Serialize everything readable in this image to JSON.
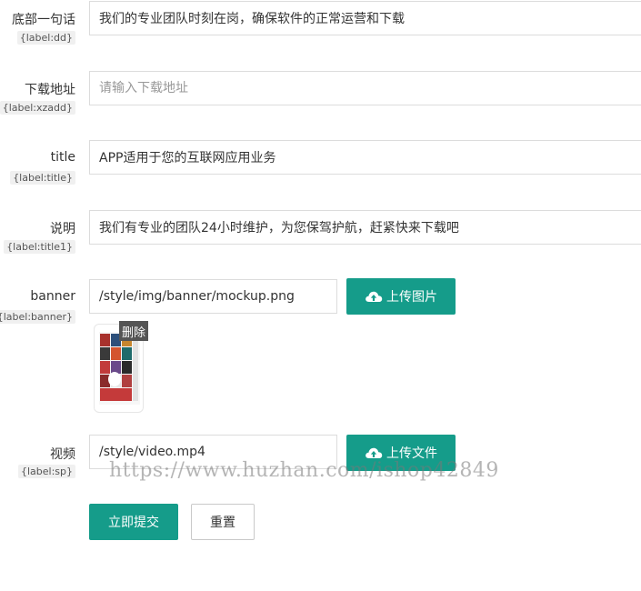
{
  "fields": [
    {
      "label": "底部一句话",
      "tag": "{label:dd}",
      "value": "我们的专业团队时刻在岗，确保软件的正常运营和下载",
      "placeholder": ""
    },
    {
      "label": "下载地址",
      "tag": "{label:xzadd}",
      "value": "",
      "placeholder": "请输入下载地址"
    },
    {
      "label": "title",
      "tag": "{label:title}",
      "value": "APP适用于您的互联网应用业务",
      "placeholder": ""
    },
    {
      "label": "说明",
      "tag": "{label:title1}",
      "value": "我们有专业的团队24小时维护，为您保驾护航，赶紧快来下载吧",
      "placeholder": ""
    }
  ],
  "banner": {
    "label": "banner",
    "tag": "{label:banner}",
    "value": "/style/img/banner/mockup.png",
    "upload_label": "上传图片",
    "delete_label": "删除"
  },
  "video": {
    "label": "视频",
    "tag": "{label:sp}",
    "value": "/style/video.mp4",
    "upload_label": "上传文件"
  },
  "actions": {
    "submit": "立即提交",
    "reset": "重置"
  },
  "watermark": "https://www.huzhan.com/ishop42849",
  "colors": {
    "accent": "#159c8a",
    "tag_bg": "#f0f0f0",
    "delete_bg": "#555555"
  }
}
